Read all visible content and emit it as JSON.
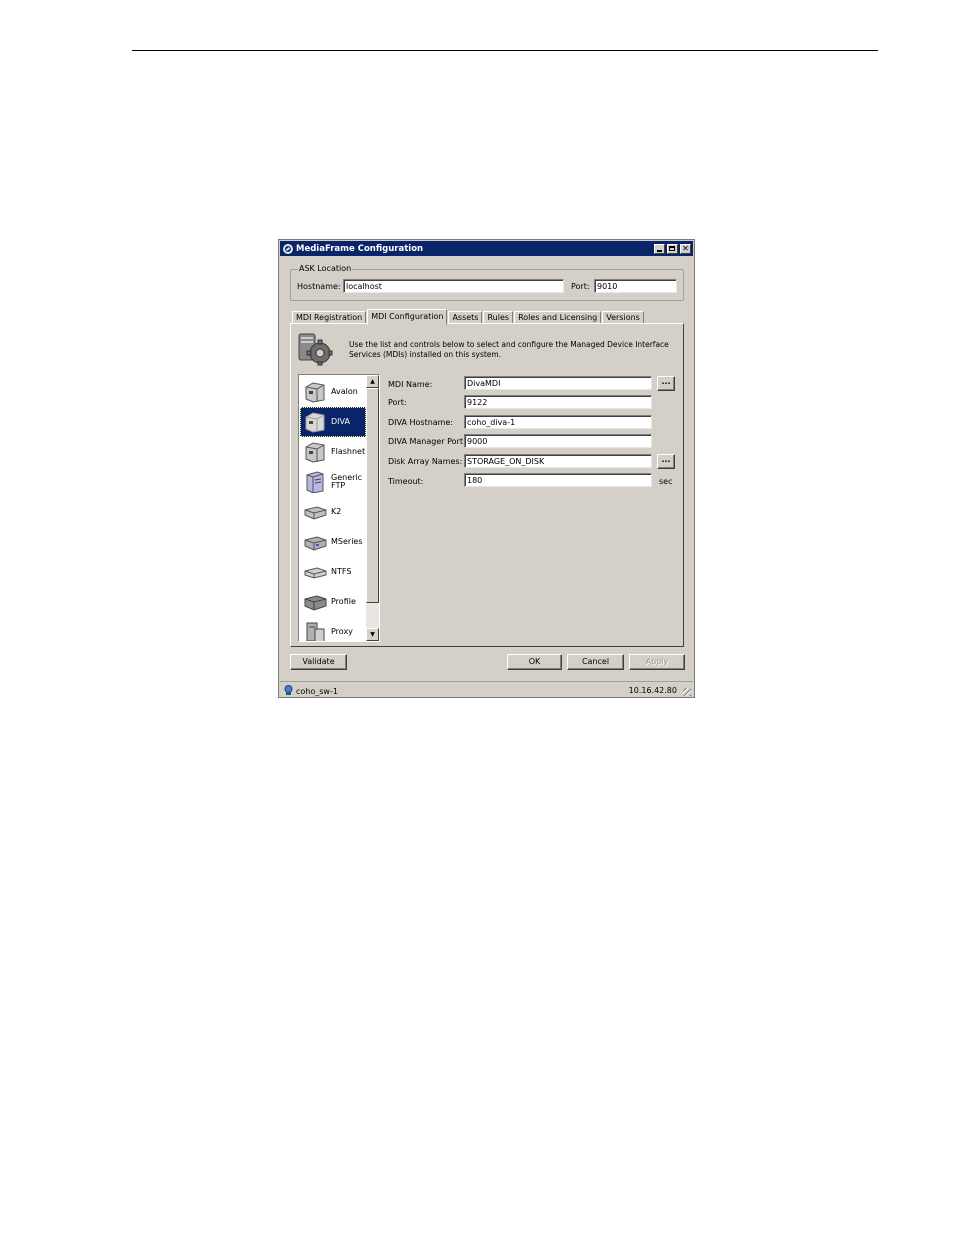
{
  "window": {
    "title": "MediaFrame Configuration"
  },
  "ask_location": {
    "legend": "ASK Location",
    "hostname_label": "Hostname:",
    "hostname_value": "localhost",
    "port_label": "Port:",
    "port_value": "9010"
  },
  "tabs": [
    {
      "label": "MDI Registration",
      "active": false
    },
    {
      "label": "MDI Configuration",
      "active": true
    },
    {
      "label": "Assets",
      "active": false
    },
    {
      "label": "Rules",
      "active": false
    },
    {
      "label": "Roles and Licensing",
      "active": false
    },
    {
      "label": "Versions",
      "active": false
    }
  ],
  "intro_text": "Use the list and controls below to select and configure the Managed Device Interface Services (MDIs) installed on this system.",
  "mdi_list": [
    {
      "label": "Avalon",
      "icon": "server-icon"
    },
    {
      "label": "DIVA",
      "icon": "server-icon",
      "selected": true
    },
    {
      "label": "Flashnet",
      "icon": "server-icon"
    },
    {
      "label": "Generic FTP",
      "icon": "ftp-server-icon"
    },
    {
      "label": "K2",
      "icon": "drive-icon"
    },
    {
      "label": "MSeries",
      "icon": "drive-icon"
    },
    {
      "label": "NTFS",
      "icon": "drive-icon"
    },
    {
      "label": "Profile",
      "icon": "drive-icon"
    },
    {
      "label": "Proxy",
      "icon": "proxy-icon"
    }
  ],
  "form": {
    "mdi_name_label": "MDI Name:",
    "mdi_name_value": "DivaMDI",
    "port_label": "Port:",
    "port_value": "9122",
    "diva_hostname_label": "DIVA Hostname:",
    "diva_hostname_value": "coho_diva-1",
    "diva_manager_port_label": "DIVA Manager Port:",
    "diva_manager_port_value": "9000",
    "disk_array_names_label": "Disk Array Names:",
    "disk_array_names_value": "STORAGE_ON_DISK",
    "timeout_label": "Timeout:",
    "timeout_value": "180",
    "timeout_unit": "sec",
    "browse_label": "..."
  },
  "buttons": {
    "validate": "Validate",
    "ok": "OK",
    "cancel": "Cancel",
    "apply": "Apply"
  },
  "status": {
    "host": "coho_sw-1",
    "ip": "10.16.42.80"
  },
  "colors": {
    "titlebar": "#0a246a",
    "selection": "#0a246a",
    "face": "#d4d0c8"
  }
}
